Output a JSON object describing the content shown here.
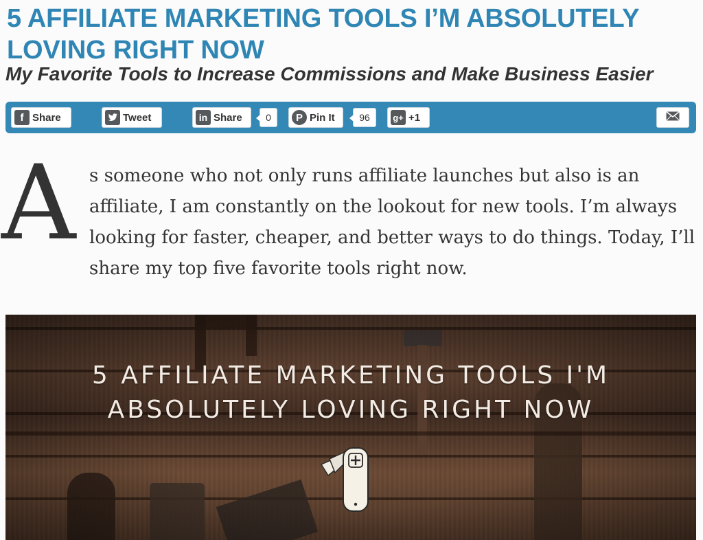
{
  "article": {
    "title": "5 AFFILIATE MARKETING TOOLS I’M ABSOLUTELY LOVING RIGHT NOW",
    "subtitle": "My Favorite Tools to Increase Commissions and Make Business Easier"
  },
  "share_bar": {
    "facebook": {
      "icon": "f",
      "label": "Share"
    },
    "twitter": {
      "icon": "t",
      "label": "Tweet"
    },
    "linkedin": {
      "icon": "in",
      "label": "Share",
      "count": "0"
    },
    "pinterest": {
      "icon": "P",
      "label": "Pin It",
      "count": "96"
    },
    "googleplus": {
      "icon": "g+",
      "label": "+1"
    },
    "email_icon": "envelope-icon",
    "accent_color": "#3388b6"
  },
  "intro": {
    "dropcap": "A",
    "text": "s someone who not only runs affiliate launches but also is an affiliate, I am constantly on the lookout for new tools. I’m always looking for faster, cheaper, and better ways to do things. Today, I’ll share my top five favorite tools right now."
  },
  "hero": {
    "line1": "5 AFFILIATE MARKETING TOOLS I'M",
    "line2": "ABSOLUTELY LOVING RIGHT NOW",
    "icon": "swiss-army-knife-icon"
  },
  "colors": {
    "title": "#2f86b4",
    "text": "#333333"
  }
}
